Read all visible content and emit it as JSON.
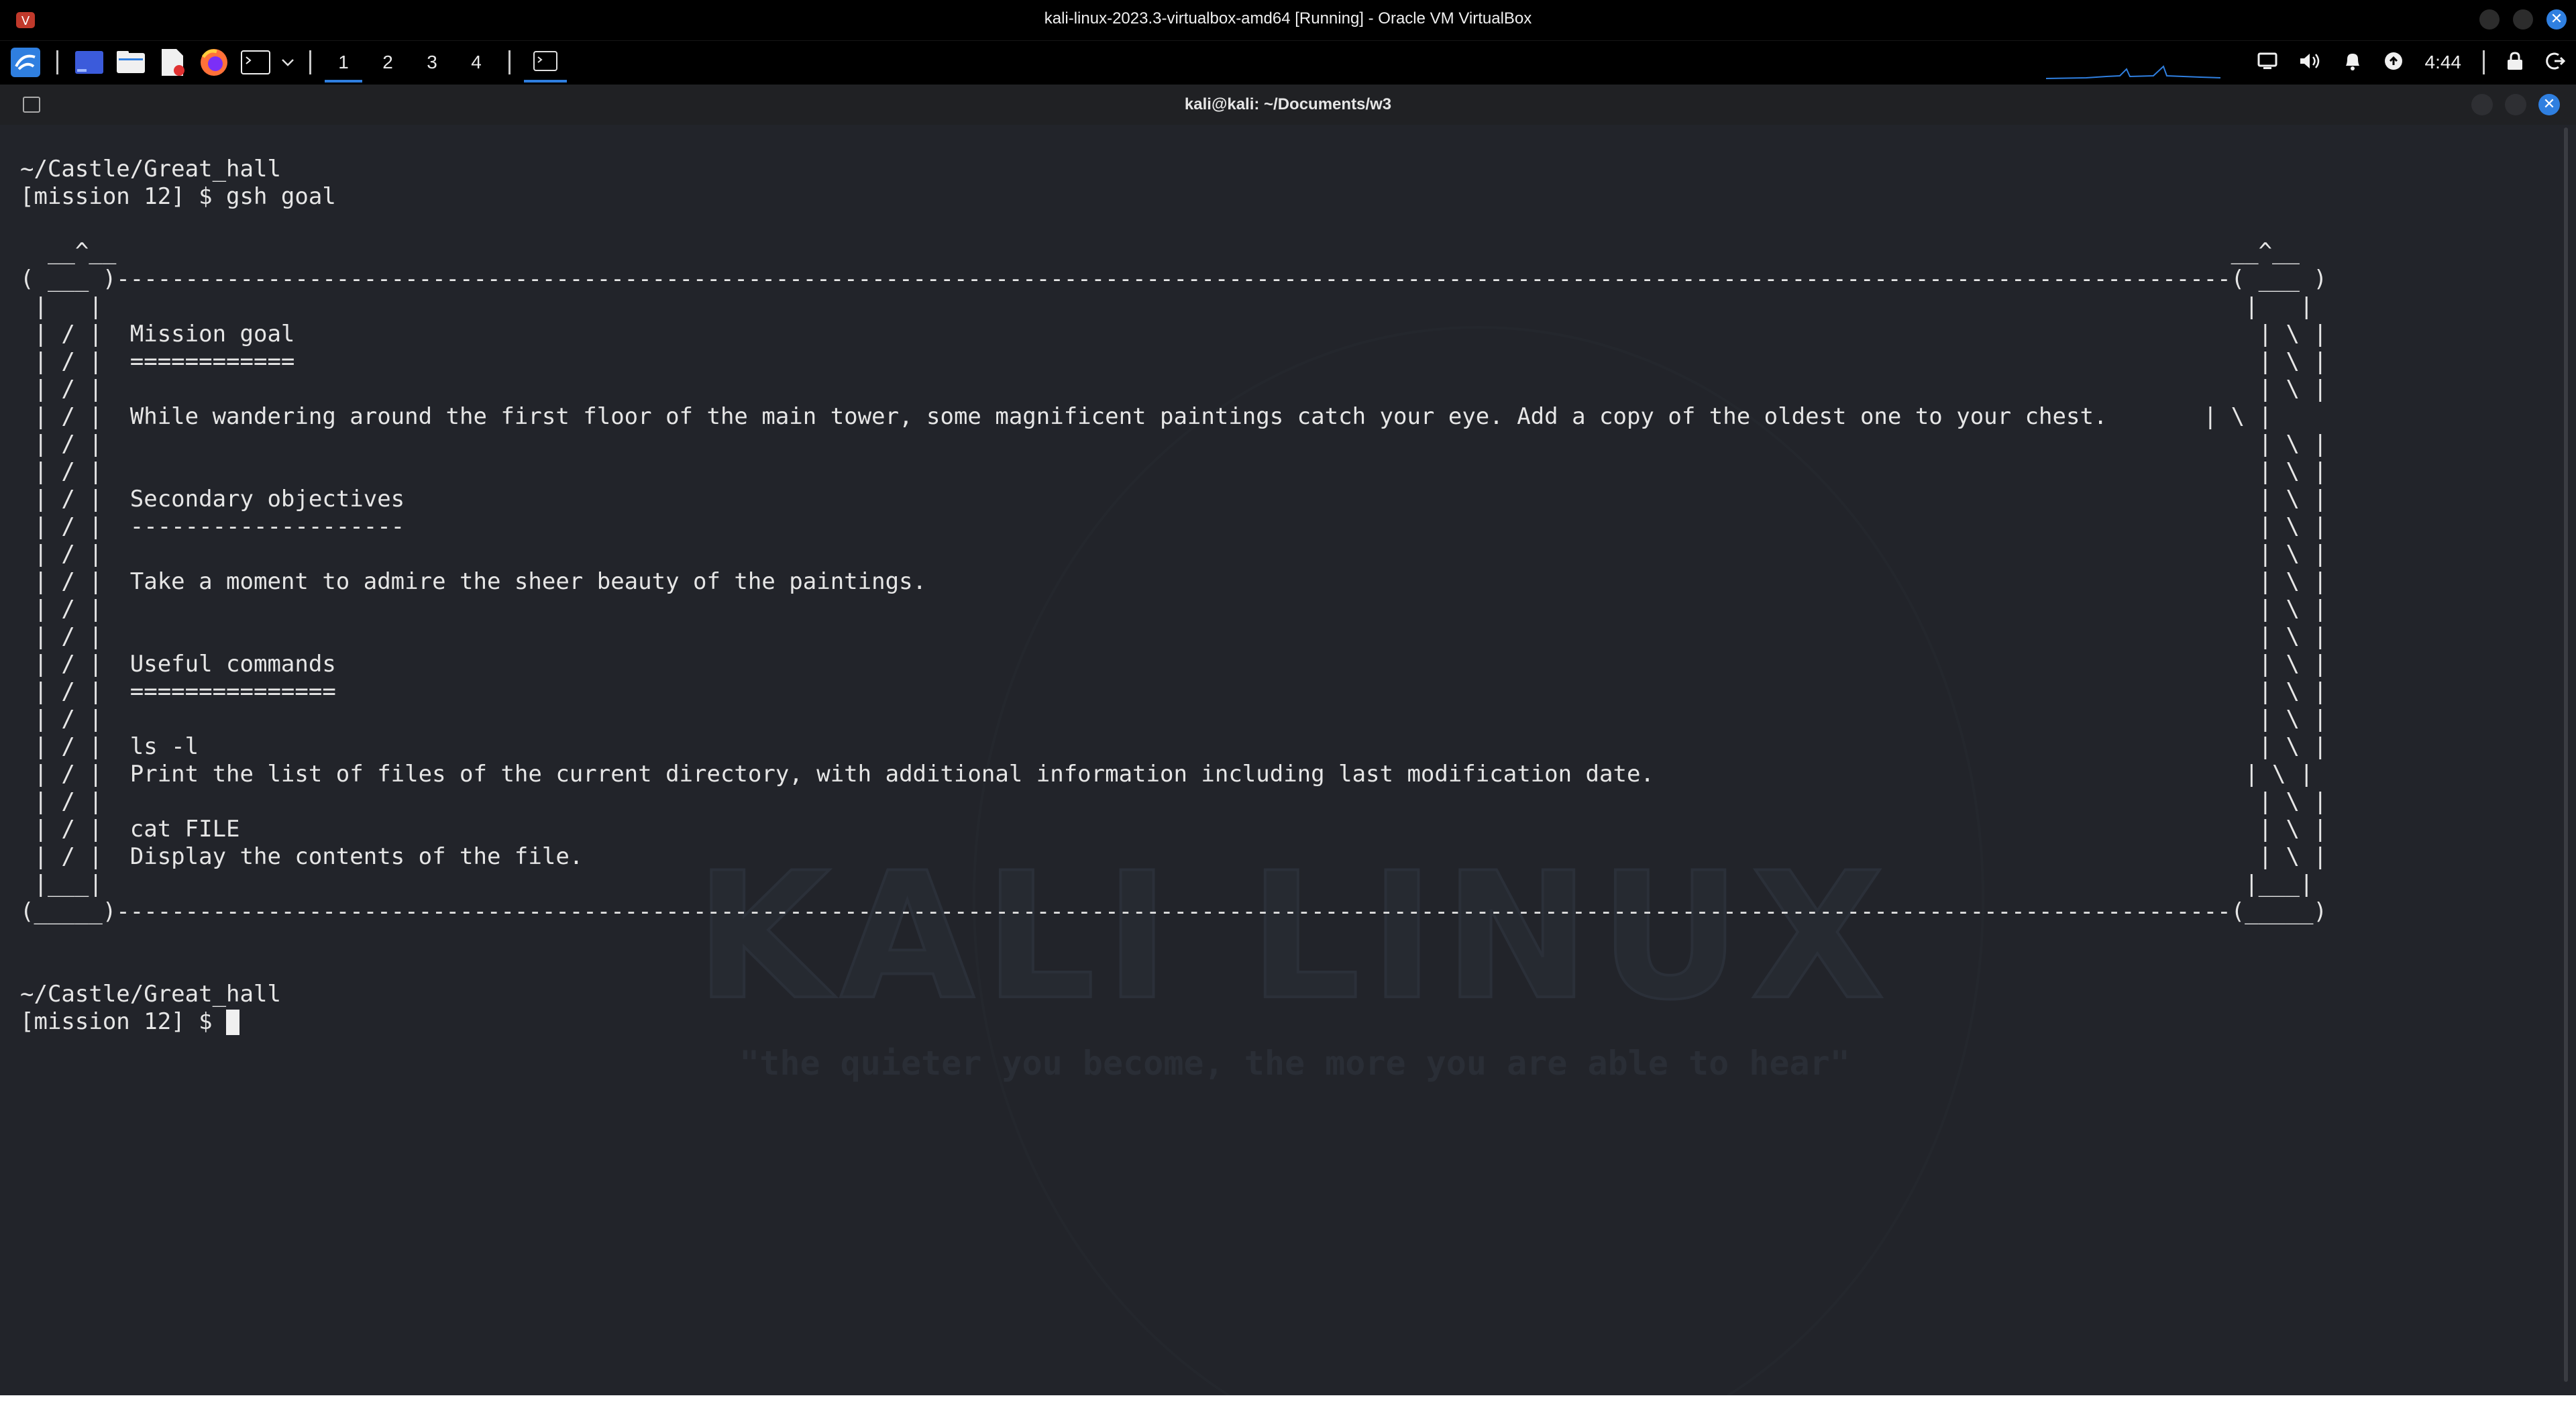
{
  "vbox": {
    "title": "kali-linux-2023.3-virtualbox-amd64 [Running] - Oracle VM VirtualBox",
    "app_icon": "virtualbox-icon",
    "buttons": [
      "minimize-icon",
      "maximize-icon",
      "close-icon"
    ],
    "close_glyph": "✕"
  },
  "panel": {
    "launchers": [
      "kali-menu-icon",
      "terminal-window-icon",
      "file-manager-icon",
      "text-editor-icon",
      "firefox-icon",
      "terminal-emulator-icon",
      "chevron-down-icon"
    ],
    "workspaces": [
      "1",
      "2",
      "3",
      "4"
    ],
    "active_workspace": "1",
    "clock": "4:44",
    "tray": [
      "display-icon",
      "volume-icon",
      "notification-bell-icon",
      "update-icon",
      "lock-icon",
      "logout-icon"
    ],
    "accent_color": "#2f7fe0"
  },
  "terminal": {
    "title": "kali@kali: ~/Documents/w3",
    "close_glyph": "✕",
    "watermark_logo": "KALI LINUX",
    "watermark_quote": "\"the quieter you become, the more you are able to hear\"",
    "output": "~/Castle/Great_hall\n[mission 12] $ gsh goal\n\n  __^__                                                                                                                                                          __^__\n( ___ )----------------------------------------------------------------------------------------------------------------------------------------------------------( ___ )\n |   |                                                                                                                                                            |   |\n | / |  Mission goal                                                                                                                                               | \\ |\n | / |  ============                                                                                                                                               | \\ |\n | / |                                                                                                                                                             | \\ |\n | / |  While wandering around the first floor of the main tower, some magnificent paintings catch your eye. Add a copy of the oldest one to your chest.       | \\ |\n | / |                                                                                                                                                             | \\ |\n | / |                                                                                                                                                             | \\ |\n | / |  Secondary objectives                                                                                                                                       | \\ |\n | / |  --------------------                                                                                                                                       | \\ |\n | / |                                                                                                                                                             | \\ |\n | / |  Take a moment to admire the sheer beauty of the paintings.                                                                                                 | \\ |\n | / |                                                                                                                                                             | \\ |\n | / |                                                                                                                                                             | \\ |\n | / |  Useful commands                                                                                                                                            | \\ |\n | / |  ===============                                                                                                                                            | \\ |\n | / |                                                                                                                                                             | \\ |\n | / |  ls -l                                                                                                                                                      | \\ |\n | / |  Print the list of files of the current directory, with additional information including last modification date.                                           | \\ |\n | / |                                                                                                                                                             | \\ |\n | / |  cat FILE                                                                                                                                                   | \\ |\n | / |  Display the contents of the file.                                                                                                                          | \\ |\n |___|                                                                                                                                                            |___|\n(_____)----------------------------------------------------------------------------------------------------------------------------------------------------------(_____)\n\n\n~/Castle/Great_hall\n[mission 12] $ "
  }
}
